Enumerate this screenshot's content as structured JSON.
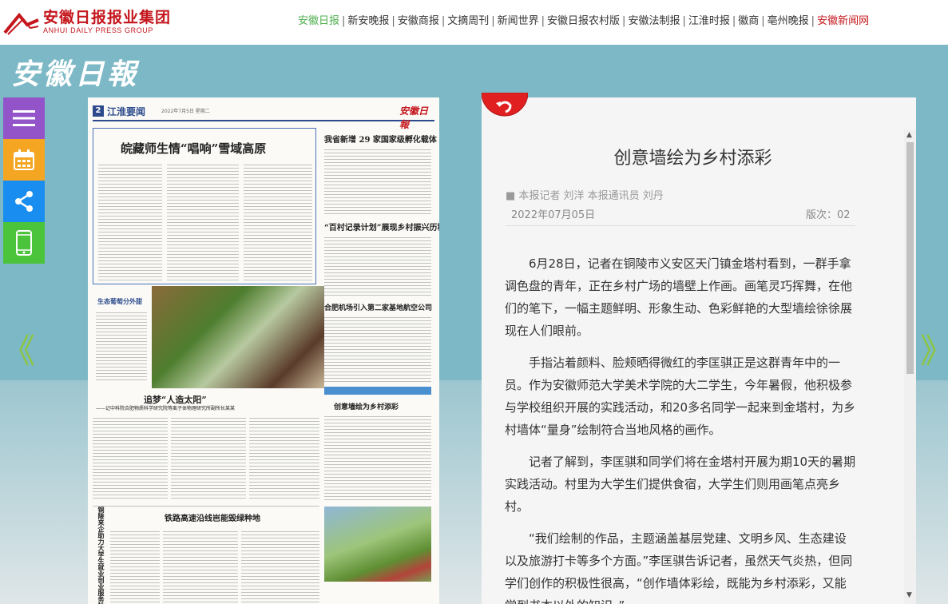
{
  "header": {
    "logo": {
      "name_cn": "安徽日报报业集团",
      "name_en": "ANHUI DAILY PRESS GROUP"
    },
    "nav": [
      {
        "label": "安徽日报",
        "state": "active"
      },
      {
        "label": "新安晚报",
        "state": "normal"
      },
      {
        "label": "安徽商报",
        "state": "normal"
      },
      {
        "label": "文摘周刊",
        "state": "normal"
      },
      {
        "label": "新闻世界",
        "state": "normal"
      },
      {
        "label": "安徽日报农村版",
        "state": "normal"
      },
      {
        "label": "安徽法制报",
        "state": "normal"
      },
      {
        "label": "江淮时报",
        "state": "normal"
      },
      {
        "label": "徽商",
        "state": "normal"
      },
      {
        "label": "亳州晚报",
        "state": "normal"
      },
      {
        "label": "安徽新闻网",
        "state": "highlight"
      }
    ]
  },
  "banner": {
    "masthead": "安徽日報"
  },
  "tools": [
    {
      "icon": "menu-icon",
      "color": "#9254c8"
    },
    {
      "icon": "calendar-icon",
      "color": "#f4a623"
    },
    {
      "icon": "share-icon",
      "color": "#1a8ef0"
    },
    {
      "icon": "phone-icon",
      "color": "#4bc43c"
    }
  ],
  "pager": {
    "prev_glyph": "《",
    "next_glyph": "》"
  },
  "newspaper": {
    "page_number": "2",
    "section": "江淮要闻",
    "date_line": "2022年7月5日 星期二",
    "masthead": "安徽日報",
    "headlines": {
      "main": "皖藏师生情“唱响”雪域高原",
      "right_top": "我省新增 29 家国家级孵化载体",
      "right_mid": "“百村记录计划”展现乡村振兴历程",
      "right_low": "合肥机场引入第二家基地航空公司",
      "photo_caption": "生态葡萄分外甜",
      "chase_sun": "追梦“人造太阳”",
      "chase_sun_sub": "——记中科院合肥物质科学研究院等离子体物理研究所副所长某某",
      "article": "创意墙绘为乡村添彩",
      "railway": "铁路高速沿线岜能毁绿种地",
      "vertical": "铜陵来企助力大学生就业创业服务站"
    }
  },
  "article": {
    "title": "创意墙绘为乡村添彩",
    "author": "■ 本报记者 刘洋 本报通讯员 刘丹",
    "date": "2022年07月05日",
    "page_label": "版次：02",
    "paragraphs": [
      "6月28日，记者在铜陵市义安区天门镇金塔村看到，一群手拿调色盘的青年，正在乡村广场的墙壁上作画。画笔灵巧挥舞，在他们的笔下，一幅主题鲜明、形象生动、色彩鲜艳的大型墙绘徐徐展现在人们眼前。",
      "手指沾着颜料、脸颊晒得微红的李匡骐正是这群青年中的一员。作为安徽师范大学美术学院的大二学生，今年暑假，他积极参与学校组织开展的实践活动，和20多名同学一起来到金塔村，为乡村墙体“量身”绘制符合当地风格的画作。",
      "记者了解到，李匡骐和同学们将在金塔村开展为期10天的暑期实践活动。村里为大学生们提供食宿，大学生们则用画笔点亮乡村。",
      "“我们绘制的作品，主题涵盖基层党建、文明乡风、生态建设以及旅游打卡等多个方面。”李匡骐告诉记者，虽然天气炎热，但同学们创作的积极性很高，“创作墙体彩绘，既能为乡村添彩，又能学到书本以外的知识。”"
    ]
  },
  "colors": {
    "brand_red": "#c4161c",
    "nav_active": "#4cae4c",
    "banner_teal": "#7cb8c5",
    "arrow_green": "#8cc63f"
  }
}
